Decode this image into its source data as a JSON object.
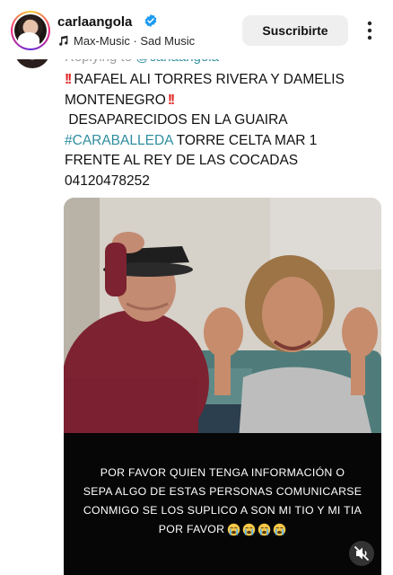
{
  "header": {
    "username": "carlaangola",
    "audio_label": "Max-Music · Sad Music",
    "subscribe_label": "Suscribirte"
  },
  "caption": {
    "reply_prefix": "Replying to",
    "reply_handle": "@carlaangola",
    "names": "RAFAEL ALI TORRES RIVERA Y DAMELIS",
    "names_2": "MONTENEGRO",
    "status": "DESAPARECIDOS EN LA GUAIRA",
    "hashtag": "#CARABALLEDA",
    "location": " TORRE CELTA MAR 1",
    "landmark": "FRENTE AL REY DE LAS  COCADAS",
    "phone": "04120478252"
  },
  "photo": {
    "overlay_lines": [
      "POR FAVOR QUIEN TENGA INFORMACIÓN O",
      "SEPA ALGO DE ESTAS PERSONAS COMUNICARSE",
      "CONMIGO SE LOS SUPLICO A SON MI TIO Y MI TIA",
      "POR FAVOR"
    ],
    "emoji": "loudly-crying-face",
    "emoji_count": 4
  },
  "icons": {
    "verified": "verified-badge-icon",
    "music": "music-note-icon",
    "more": "more-options-icon",
    "mute": "muted-speaker-icon"
  },
  "colors": {
    "accent_link": "#2f8ea0",
    "verified_blue": "#1d9bf0",
    "alert_red": "#e02020",
    "button_bg": "#efefef"
  }
}
